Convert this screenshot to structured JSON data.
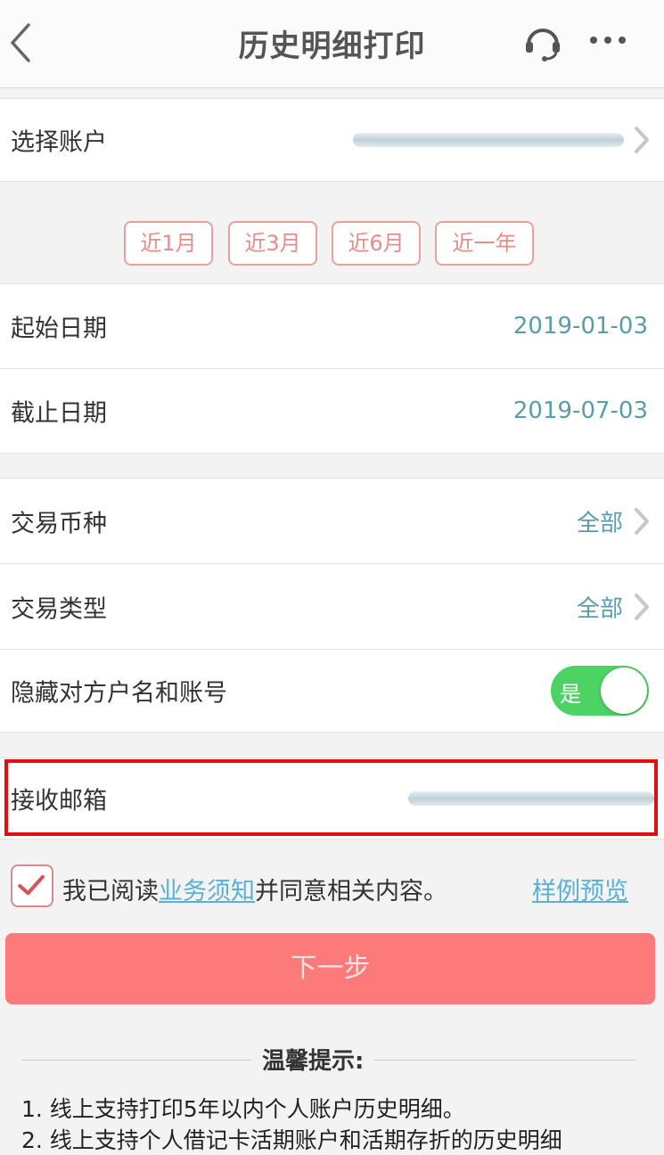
{
  "nav": {
    "title": "历史明细打印"
  },
  "account_row": {
    "label": "选择账户"
  },
  "quick_ranges": [
    "近1月",
    "近3月",
    "近6月",
    "近一年"
  ],
  "start_date": {
    "label": "起始日期",
    "value": "2019-01-03"
  },
  "end_date": {
    "label": "截止日期",
    "value": "2019-07-03"
  },
  "currency": {
    "label": "交易币种",
    "value": "全部"
  },
  "txn_type": {
    "label": "交易类型",
    "value": "全部"
  },
  "hide_counterparty": {
    "label": "隐藏对方户名和账号",
    "toggle_label": "是",
    "on": true
  },
  "email": {
    "label": "接收邮箱"
  },
  "agreement": {
    "prefix": "我已阅读",
    "link": "业务须知",
    "suffix": "并同意相关内容。",
    "sample_link": "样例预览",
    "checked": true
  },
  "next_button": "下一步",
  "tips": {
    "title": "温馨提示:",
    "items": [
      "1.  线上支持打印5年以内个人账户历史明细。",
      "2.  线上支持个人借记卡活期账户和活期存折的历史明细"
    ]
  },
  "colors": {
    "accent_red": "#fd7a7b",
    "chip_border": "#e6a19f",
    "value_blue": "#5a9cab",
    "link_blue": "#5ab0d6",
    "toggle_green": "#4cd364",
    "highlight_red": "#e01010"
  }
}
